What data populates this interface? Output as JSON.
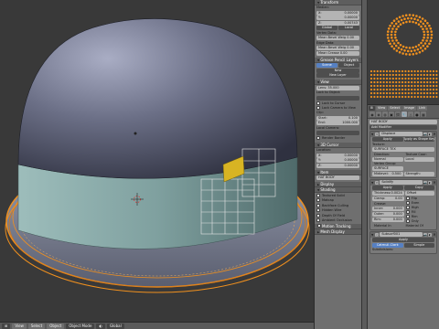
{
  "viewport": {
    "header_buttons": [
      "⊞",
      "View",
      "Select",
      "Object",
      "Object Mode",
      "◐",
      "Global"
    ]
  },
  "npanel": {
    "transform": {
      "title": "Transform",
      "median_label": "Median:",
      "x": {
        "label": "X:",
        "value": "0.00000"
      },
      "y": {
        "label": "Y:",
        "value": "0.00000"
      },
      "z": {
        "label": "Z:",
        "value": "0.00743"
      },
      "global_label": "Global",
      "local_label": "Local",
      "vertex_data_label": "Vertex Data:",
      "mean_bevel_weight": "Mean Bevel Weig 0.00",
      "edge_data_label": "Edge Data:",
      "mean_bevel_weight_edge": "Mean Bevel Weig 0.00",
      "mean_crease": "Mean Crease 0.00"
    },
    "grease_pencil": {
      "title": "Grease Pencil Layers",
      "scene_label": "Scene",
      "object_label": "Object",
      "new_label": "New",
      "new_layer_label": "New Layer"
    },
    "view": {
      "title": "View",
      "lens": "Lens: 35.000",
      "lock_to_object_label": "Lock to Object:",
      "lock_to_cursor": "Lock to Cursor",
      "lock_camera_to_view": "Lock Camera to View",
      "clip_label": "Clip:",
      "clip_start": {
        "label": "Start:",
        "value": "0.100"
      },
      "clip_end": {
        "label": "End:",
        "value": "1000.000"
      },
      "local_camera_label": "Local Camera:",
      "render_border": "Render Border"
    },
    "cursor3d": {
      "title": "3D Cursor",
      "location_label": "Location:",
      "x": {
        "label": "X:",
        "value": "0.00000"
      },
      "y": {
        "label": "Y:",
        "value": "0.00000"
      },
      "z": {
        "label": "Z:",
        "value": "0.00000"
      }
    },
    "item": {
      "title": "Item",
      "name": "HAT BODY"
    },
    "collapsed": [
      "Display",
      "Shading"
    ],
    "display_toggles": [
      {
        "label": "Textured Solid",
        "checked": false
      },
      {
        "label": "Matcap",
        "checked": false
      },
      {
        "label": "Backface Culling",
        "checked": false
      },
      {
        "label": "Hidden Wire",
        "checked": false
      },
      {
        "label": "Depth Of Field",
        "checked": false
      },
      {
        "label": "Ambient Occlusion",
        "checked": false
      }
    ],
    "motion_tracking": "Motion Tracking",
    "mesh_display": "Mesh Display"
  },
  "miniview": {
    "header_buttons": [
      "⊞",
      "View",
      "Select",
      "Image",
      "Link"
    ]
  },
  "props": {
    "object_name": "HAT BODY",
    "add_modifier_label": "Add Modifier",
    "displace": {
      "name": "Displace",
      "apply_label": "Apply",
      "apply_shape_label": "Apply as Shape Key",
      "texture_label": "Texture:",
      "texture_value": "SURFACE TEX",
      "direction_label": "Direction:",
      "direction_value": "Normal",
      "texture_coords_label": "Texture Coor:",
      "texture_coords_value": "Local",
      "vertex_group_label": "Vertex Group:",
      "vertex_group_value": "SURFACE",
      "midlevel": {
        "label": "Midlevel:",
        "value": "0.500"
      },
      "strength_label": "Strength:"
    },
    "solidify": {
      "name": "Solidify",
      "apply_label": "Apply",
      "copy_label": "Copy",
      "thickness": {
        "label": "Thickness:",
        "value": "0.0024"
      },
      "offset_label": "Offset",
      "clamp": {
        "label": "Clamp:",
        "value": "0.00"
      },
      "crease_label": "Crease:",
      "inner": {
        "label": "Inner:",
        "value": "0.000"
      },
      "outer": {
        "label": "Outer:",
        "value": "0.000"
      },
      "rim": {
        "label": "Rim:",
        "value": "0.000"
      },
      "toggles": [
        "Flip",
        "Even",
        "High",
        "Fill",
        "Rim",
        "Only"
      ],
      "material_label": "Material In",
      "material_offset_label": "Material Of"
    },
    "subsurf": {
      "name": "Subsurf001",
      "apply_label": "Apply",
      "catmull_label": "Catmull-Clark",
      "simple_label": "Simple",
      "subdivisions_label": "Subdivisions:"
    }
  },
  "colors": {
    "accent_orange": "#f0901e",
    "selected_blue": "#5680c2"
  }
}
